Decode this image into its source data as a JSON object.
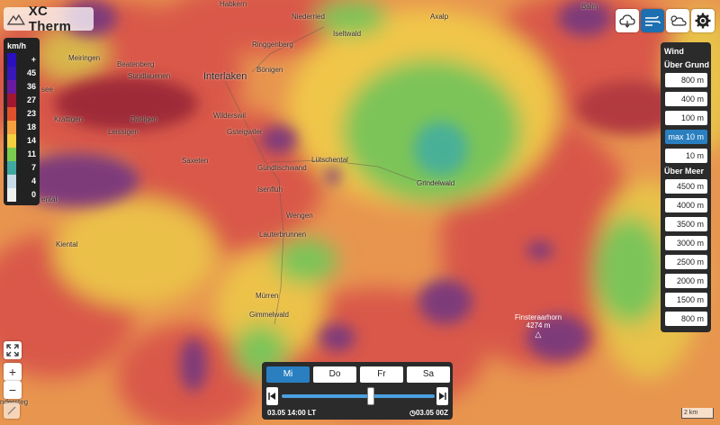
{
  "app": {
    "name": "XC Therm"
  },
  "legend": {
    "unit": "km/h",
    "rows": [
      {
        "label": "+",
        "color": "#2a10c0"
      },
      {
        "label": "45",
        "color": "#3818b8"
      },
      {
        "label": "36",
        "color": "#6a1aa0"
      },
      {
        "label": "27",
        "color": "#a01830"
      },
      {
        "label": "23",
        "color": "#e0502c"
      },
      {
        "label": "18",
        "color": "#f5a040"
      },
      {
        "label": "14",
        "color": "#f2d040"
      },
      {
        "label": "11",
        "color": "#7ccc50"
      },
      {
        "label": "7",
        "color": "#40a8a0"
      },
      {
        "label": "4",
        "color": "#c8dce8"
      },
      {
        "label": "0",
        "color": "#f0f0f0"
      }
    ]
  },
  "top_icons": [
    "cloud-thermal-icon",
    "wind-icon",
    "weather-icon",
    "settings-icon"
  ],
  "wind_panel": {
    "title": "Wind",
    "ground_title": "Über Grund",
    "ground_levels": [
      "800 m",
      "400 m",
      "100 m",
      "max 10 m",
      "10 m"
    ],
    "ground_active": "max 10 m",
    "sea_title": "Über Meer",
    "sea_levels": [
      "4500 m",
      "4000 m",
      "3500 m",
      "3000 m",
      "2500 m",
      "2000 m",
      "1500 m",
      "800 m"
    ]
  },
  "days": [
    "Mi",
    "Do",
    "Fr",
    "Sa"
  ],
  "active_day": "Mi",
  "time": {
    "left": "03.05 14:00 LT",
    "right": "03.05 00Z",
    "progress": 0.58
  },
  "scale_label": "2 km",
  "places": [
    {
      "name": "Habkern",
      "big": false
    },
    {
      "name": "Niederried",
      "big": false
    },
    {
      "name": "Iseltwald",
      "big": false
    },
    {
      "name": "Axalp",
      "big": false
    },
    {
      "name": "Meiringen",
      "big": false
    },
    {
      "name": "Beatenberg",
      "big": false
    },
    {
      "name": "Sundlauenen",
      "big": false
    },
    {
      "name": "Interlaken",
      "big": true
    },
    {
      "name": "Ringgenberg",
      "big": false
    },
    {
      "name": "Bönigen",
      "big": false
    },
    {
      "name": "Krattigen",
      "big": false
    },
    {
      "name": "Därligen",
      "big": false
    },
    {
      "name": "Wilderswil",
      "big": false
    },
    {
      "name": "Leissigen",
      "big": false
    },
    {
      "name": "Gsteigwiler",
      "big": false
    },
    {
      "name": "Saxeten",
      "big": false
    },
    {
      "name": "Gündlischwand",
      "big": false
    },
    {
      "name": "Lütschental",
      "big": false
    },
    {
      "name": "Grindelwald",
      "big": false
    },
    {
      "name": "Isenfluh",
      "big": false
    },
    {
      "name": "Wengen",
      "big": false
    },
    {
      "name": "Lauterbrunnen",
      "big": false
    },
    {
      "name": "Kiental",
      "big": false
    },
    {
      "name": "Mürren",
      "big": false
    },
    {
      "name": "Gimmelwald",
      "big": false
    },
    {
      "name": "see",
      "big": false
    },
    {
      "name": "ental",
      "big": false
    },
    {
      "name": "Balm",
      "big": false
    },
    {
      "name": "ndersteg",
      "big": false
    }
  ],
  "peak": {
    "name": "Finsteraarhorn",
    "elevation": "4274 m"
  }
}
